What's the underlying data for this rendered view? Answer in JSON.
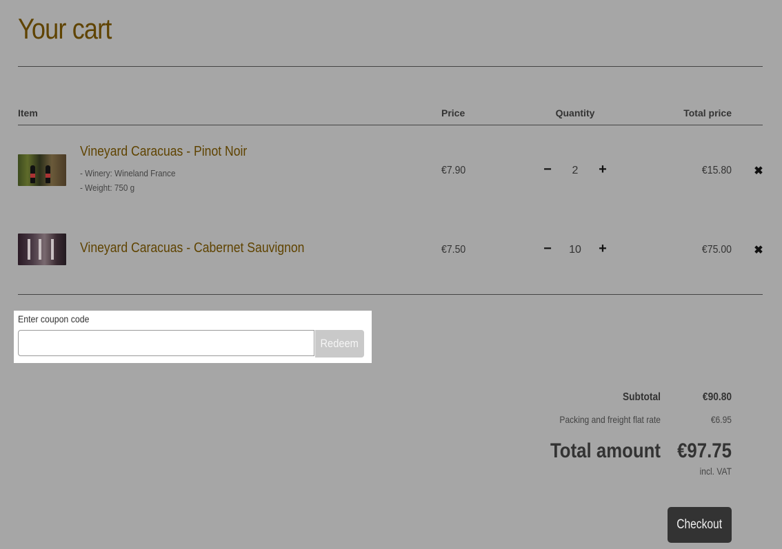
{
  "page": {
    "title": "Your cart"
  },
  "table": {
    "headers": {
      "item": "Item",
      "price": "Price",
      "quantity": "Quantity",
      "total": "Total price"
    }
  },
  "items": [
    {
      "name": "Vineyard Caracuas - Pinot Noir",
      "details": [
        "- Winery: Wineland France",
        "- Weight: 750 g"
      ],
      "price": "€7.90",
      "quantity": "2",
      "total": "€15.80",
      "thumbnail_icon": "wine-bottles-image"
    },
    {
      "name": "Vineyard Caracuas - Cabernet Sauvignon",
      "details": [],
      "price": "€7.50",
      "quantity": "10",
      "total": "€75.00",
      "thumbnail_icon": "wine-cellar-image"
    }
  ],
  "controls": {
    "decrease": "−",
    "increase": "+",
    "remove": "✖"
  },
  "coupon": {
    "label": "Enter coupon code",
    "placeholder": "",
    "value": "",
    "button": "Redeem"
  },
  "summary": {
    "subtotal_label": "Subtotal",
    "subtotal_value": "€90.80",
    "shipping_label": "Packing and freight flat rate",
    "shipping_value": "€6.95",
    "total_label": "Total amount",
    "total_value": "€97.75",
    "vat_note": "incl. VAT"
  },
  "checkout": {
    "label": "Checkout"
  },
  "colors": {
    "background": "#a6a6a6",
    "accent": "#5f4300",
    "button_dark": "#333333"
  }
}
